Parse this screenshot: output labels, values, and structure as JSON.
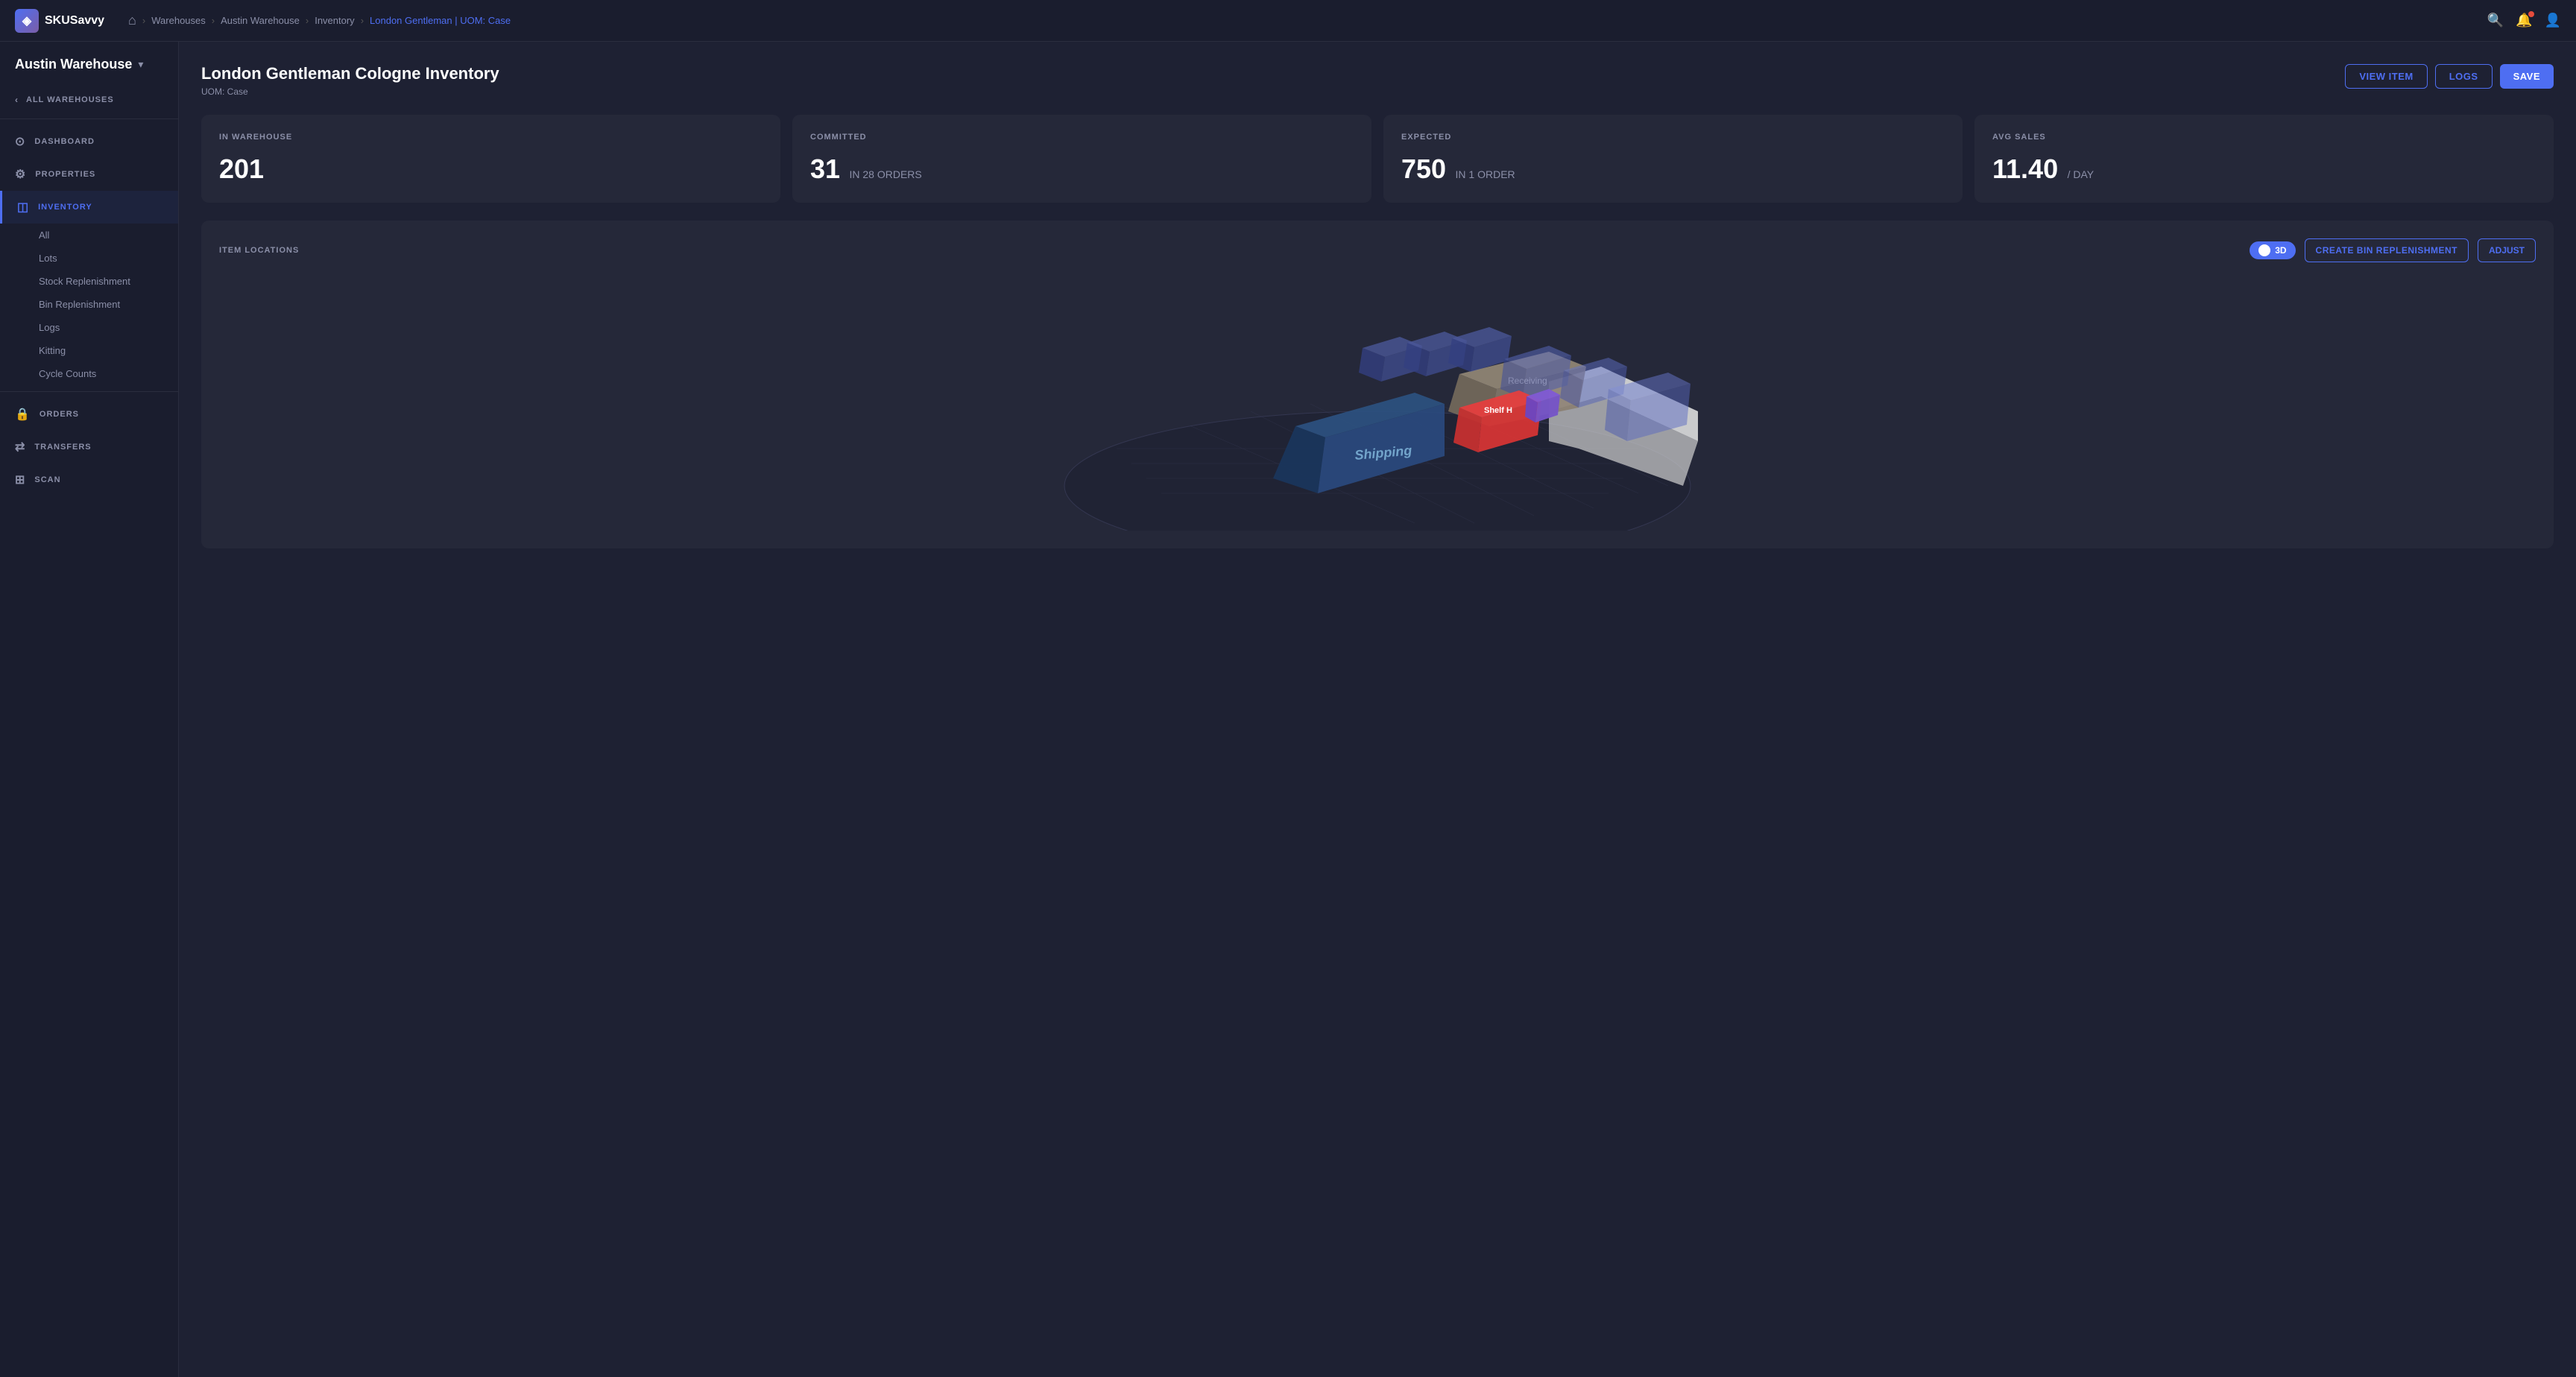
{
  "app": {
    "name": "SKUSavvy",
    "logo_symbol": "◈"
  },
  "breadcrumb": {
    "home": "⌂",
    "items": [
      {
        "label": "Warehouses",
        "active": false
      },
      {
        "label": "Austin Warehouse",
        "active": false
      },
      {
        "label": "Inventory",
        "active": false
      },
      {
        "label": "London Gentleman | UOM: Case",
        "active": true
      }
    ]
  },
  "topnav": {
    "search_tooltip": "Search",
    "notifications_tooltip": "Notifications",
    "profile_tooltip": "Profile"
  },
  "sidebar": {
    "warehouse_name": "Austin Warehouse",
    "all_warehouses_label": "ALL WAREHOUSES",
    "nav_items": [
      {
        "id": "dashboard",
        "label": "DASHBOARD",
        "icon": "⊙"
      },
      {
        "id": "properties",
        "label": "PROPERTIES",
        "icon": "⚙"
      },
      {
        "id": "inventory",
        "label": "INVENTORY",
        "icon": "◫",
        "active": true
      }
    ],
    "inventory_sub_items": [
      {
        "id": "all",
        "label": "All"
      },
      {
        "id": "lots",
        "label": "Lots"
      },
      {
        "id": "stock-replenishment",
        "label": "Stock Replenishment"
      },
      {
        "id": "bin-replenishment",
        "label": "Bin Replenishment"
      },
      {
        "id": "logs",
        "label": "Logs"
      },
      {
        "id": "kitting",
        "label": "Kitting"
      },
      {
        "id": "cycle-counts",
        "label": "Cycle Counts"
      }
    ],
    "bottom_items": [
      {
        "id": "orders",
        "label": "ORDERS",
        "icon": "🔒"
      },
      {
        "id": "transfers",
        "label": "TRANSFERS",
        "icon": "⇄"
      },
      {
        "id": "scan",
        "label": "SCAN",
        "icon": "⊞"
      }
    ]
  },
  "page": {
    "title": "London Gentleman Cologne Inventory",
    "subtitle": "UOM: Case",
    "actions": {
      "view_item": "VIEW ITEM",
      "logs": "LOGS",
      "save": "SAVE"
    }
  },
  "stats": [
    {
      "id": "in-warehouse",
      "label": "IN WAREHOUSE",
      "value": "201",
      "sub": ""
    },
    {
      "id": "committed",
      "label": "COMMITTED",
      "value": "31",
      "sub": "IN 28 ORDERS"
    },
    {
      "id": "expected",
      "label": "EXPECTED",
      "value": "750",
      "sub": "IN 1 ORDER"
    },
    {
      "id": "avg-sales",
      "label": "AVG SALES",
      "value": "11.40",
      "sub": "/ DAY"
    }
  ],
  "locations": {
    "title": "ITEM LOCATIONS",
    "toggle_3d_label": "3D",
    "create_btn": "CREATE BIN REPLENISHMENT",
    "adjust_btn": "ADJUST",
    "warehouse_labels": {
      "shipping": "Shipping",
      "receiving": "Receiving",
      "shelf_h": "Shelf H"
    }
  }
}
